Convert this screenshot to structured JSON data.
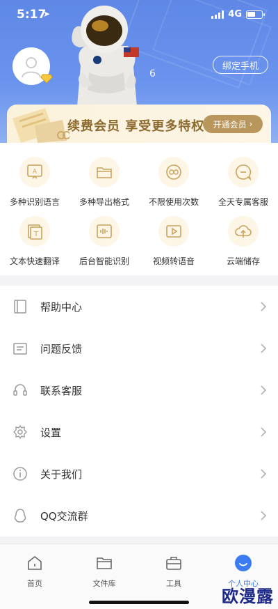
{
  "status": {
    "time": "5:17",
    "network": "4G"
  },
  "profile": {
    "user_id": "6",
    "bind_phone": "绑定手机"
  },
  "vip": {
    "text": "续费会员 享受更多特权",
    "button": "开通会员"
  },
  "features": [
    {
      "label": "多种识别语言",
      "icon": "language-icon"
    },
    {
      "label": "多种导出格式",
      "icon": "folder-icon"
    },
    {
      "label": "不限使用次数",
      "icon": "infinity-icon"
    },
    {
      "label": "全天专属客服",
      "icon": "chat-icon"
    },
    {
      "label": "文本快速翻译",
      "icon": "translate-icon"
    },
    {
      "label": "后台智能识别",
      "icon": "waveform-icon"
    },
    {
      "label": "视频转语音",
      "icon": "video-icon"
    },
    {
      "label": "云端储存",
      "icon": "cloud-upload-icon"
    }
  ],
  "menu": [
    {
      "label": "帮助中心",
      "icon": "book-icon"
    },
    {
      "label": "问题反馈",
      "icon": "feedback-icon"
    },
    {
      "label": "联系客服",
      "icon": "headset-icon"
    },
    {
      "label": "设置",
      "icon": "gear-icon"
    },
    {
      "label": "关于我们",
      "icon": "info-icon"
    },
    {
      "label": "QQ交流群",
      "icon": "qq-icon"
    }
  ],
  "tabs": [
    {
      "label": "首页",
      "icon": "home-icon",
      "active": false
    },
    {
      "label": "文件库",
      "icon": "folder-icon",
      "active": false
    },
    {
      "label": "工具",
      "icon": "toolbox-icon",
      "active": false
    },
    {
      "label": "个人中心",
      "icon": "profile-icon",
      "active": true
    }
  ],
  "watermark": "欧漫露",
  "colors": {
    "header": "#6b94ee",
    "vip_gold": "#b9975c",
    "active_tab": "#3b7cf2",
    "feature_bg": "#fdf5e6"
  }
}
